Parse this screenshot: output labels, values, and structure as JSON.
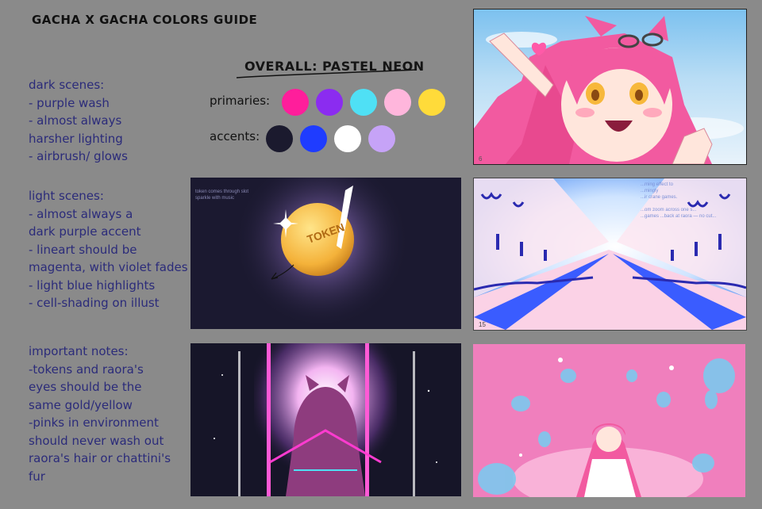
{
  "title": "GACHA X GACHA COLORS GUIDE",
  "notes": {
    "dark": "dark scenes:\n- purple wash\n- almost always\nharsher lighting\n- airbrush/ glows",
    "light": "light scenes:\n- almost always a\ndark purple accent\n- lineart should be\nmagenta, with violet fades\n- light blue highlights\n- cell-shading on illust",
    "important": "important notes:\n-tokens and raora's\neyes should be the\nsame gold/yellow\n-pinks in environment\nshould never wash out\nraora's hair or chattini's\nfur"
  },
  "palette": {
    "heading": "OVERALL: PASTEL NEON",
    "primaries_label": "primaries:",
    "accents_label": "accents:",
    "primaries": [
      "#ff1e9b",
      "#8b2cf0",
      "#4fe0f5",
      "#ffb6dc",
      "#ffdb3a"
    ],
    "accents": [
      "#1b1a2e",
      "#1f3cff",
      "#ffffff",
      "#c6a3f7"
    ]
  },
  "panels": {
    "token_caption": "token comes through slot\nsparkle with music",
    "token_text": "TOKEN",
    "corridor_caption": "...ming effect to\n...mingly\n...ir crane games.\n\n...om zoom across one s...\n...games ...back at raora — no cut...",
    "corridor_corner": "15",
    "hero_corner": "6"
  }
}
